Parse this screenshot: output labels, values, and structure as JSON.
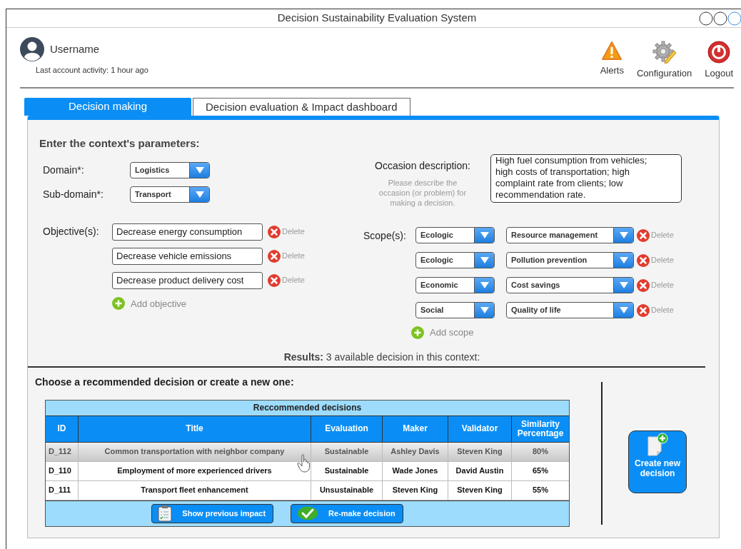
{
  "window": {
    "title": "Decision Sustainability Evaluation System"
  },
  "user": {
    "name": "Username",
    "activity": "Last account activity: 1 hour ago"
  },
  "toolbar": [
    {
      "kind": "alerts",
      "label": "Alerts"
    },
    {
      "kind": "configuration",
      "label": "Configuration"
    },
    {
      "kind": "logout",
      "label": "Logout"
    }
  ],
  "tabs": [
    {
      "label": "Decision making",
      "selected": true
    },
    {
      "label": "Decision evaluation & Impact dashboard",
      "selected": false
    }
  ],
  "context": {
    "heading": "Enter the context's parameters:",
    "domain": {
      "label": "Domain*:",
      "value": "Logistics"
    },
    "subdomain": {
      "label": "Sub-domain*:",
      "value": "Transport"
    },
    "objectives": {
      "label": "Objective(s):",
      "add_label": "Add objective",
      "items": [
        {
          "value": "Decrease energy consumption",
          "delete_label": "Delete"
        },
        {
          "value": "Decrease vehicle emissions",
          "delete_label": "Delete"
        },
        {
          "value": "Decrease product delivery cost",
          "delete_label": "Delete"
        }
      ]
    }
  },
  "occasion": {
    "label": "Occasion description:",
    "hint": "Please describe the occasion (or problem) for making a decision.",
    "value": "High fuel consumption from vehicles; high costs of transportation; high complaint rate from clients; low recommendation rate."
  },
  "scopes": {
    "label": "Scope(s):",
    "add_label": "Add scope",
    "rows": [
      {
        "category": "Ecologic",
        "subcategory": "Resource management",
        "delete_label": "Delete"
      },
      {
        "category": "Ecologic",
        "subcategory": "Pollution prevention",
        "delete_label": "Delete"
      },
      {
        "category": "Economic",
        "subcategory": "Cost savings",
        "delete_label": "Delete"
      },
      {
        "category": "Social",
        "subcategory": "Quality of life",
        "delete_label": "Delete"
      }
    ]
  },
  "results": "**Results:** 3 available decision in this context:",
  "choose_heading": "Choose a recommended decision or create a new one:",
  "table": {
    "caption": "Reccommended decisions",
    "columns": [
      "ID",
      "Title",
      "Evaluation",
      "Maker",
      "Validator",
      "Similarity Percentage"
    ],
    "rows": [
      {
        "selected": true,
        "cells": [
          "D_112",
          "Common transportation with neighbor company",
          "Sustainable",
          "Ashley Davis",
          "Steven King",
          "80%"
        ]
      },
      {
        "selected": false,
        "cells": [
          "D_110",
          "Employment of more experienced drivers",
          "Sustainable",
          "Wade Jones",
          "David Austin",
          "65%"
        ]
      },
      {
        "selected": false,
        "cells": [
          "D_111",
          "Transport fleet enhancement",
          "Unsustainable",
          "Steven King",
          "Steven King",
          "55%"
        ]
      }
    ]
  },
  "table_buttons": [
    {
      "kind": "impact",
      "label": "Show previous impact"
    },
    {
      "kind": "remake",
      "label": "Re-make decision"
    }
  ],
  "create_button": {
    "label": "Create new decision"
  }
}
